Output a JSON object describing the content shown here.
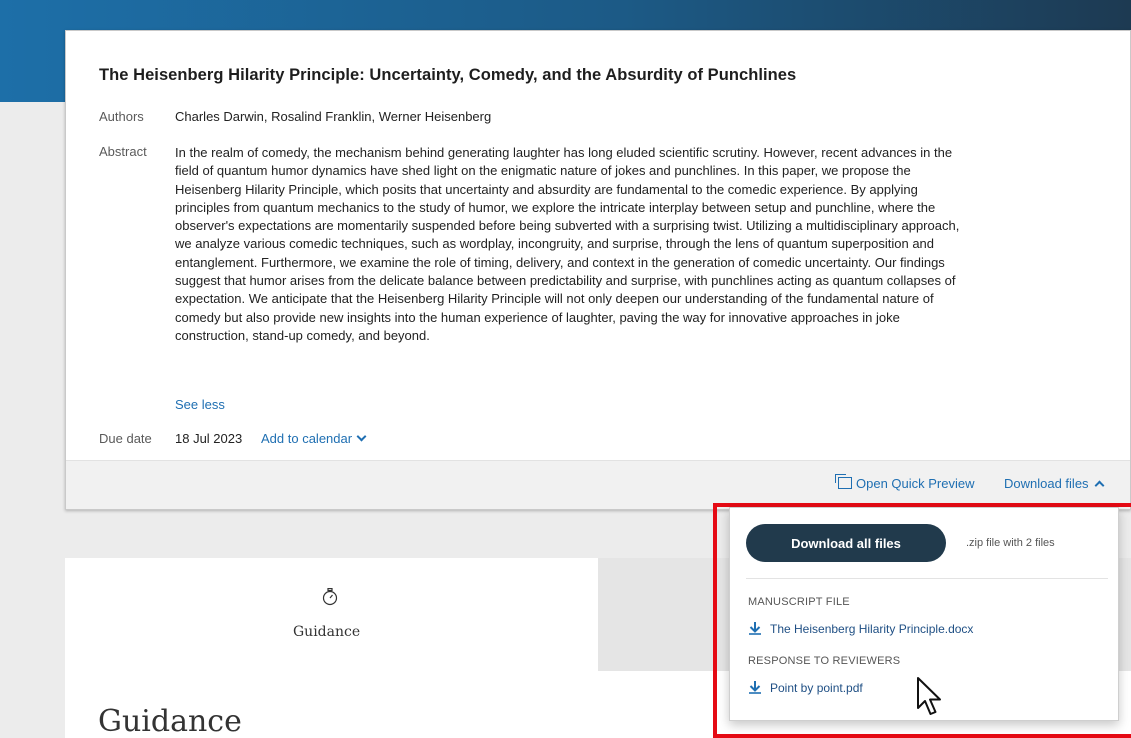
{
  "submission": {
    "title": "The Heisenberg Hilarity Principle: Uncertainty, Comedy, and the Absurdity of Punchlines",
    "authors_label": "Authors",
    "authors": "Charles Darwin, Rosalind Franklin, Werner Heisenberg",
    "abstract_label": "Abstract",
    "abstract": "In the realm of comedy, the mechanism behind generating laughter has long eluded scientific scrutiny. However, recent advances in the field of quantum humor dynamics have shed light on the enigmatic nature of jokes and punchlines. In this paper, we propose the Heisenberg Hilarity Principle, which posits that uncertainty and absurdity are fundamental to the comedic experience. By applying principles from quantum mechanics to the study of humor, we explore the intricate interplay between setup and punchline, where the observer's expectations are momentarily suspended before being subverted with a surprising twist. Utilizing a multidisciplinary approach, we analyze various comedic techniques, such as wordplay, incongruity, and surprise, through the lens of quantum superposition and entanglement. Furthermore, we examine the role of timing, delivery, and context in the generation of comedic uncertainty. Our findings suggest that humor arises from the delicate balance between predictability and surprise, with punchlines acting as quantum collapses of expectation. We anticipate that the Heisenberg Hilarity Principle will not only deepen our understanding of the fundamental nature of comedy but also provide new insights into the human experience of laughter, paving the way for innovative approaches in joke construction, stand-up comedy, and beyond.",
    "see_less": "See less",
    "due_date_label": "Due date",
    "due_date": "18 Jul 2023",
    "add_to_calendar": "Add to calendar"
  },
  "footer": {
    "open_quick_preview": "Open Quick Preview",
    "download_files": "Download files"
  },
  "download_menu": {
    "download_all_label": "Download all files",
    "zip_note": ".zip file with 2 files",
    "sections": [
      {
        "label": "MANUSCRIPT FILE",
        "file": "The Heisenberg Hilarity Principle.docx"
      },
      {
        "label": "RESPONSE TO REVIEWERS",
        "file": "Point by point.pdf"
      }
    ]
  },
  "guidance": {
    "tab_label": "Guidance",
    "heading": "Guidance"
  },
  "colors": {
    "link": "#1f6fb2",
    "button": "#213a4c",
    "highlight": "#e50a14",
    "header_band": "#1c5a86"
  },
  "icons": [
    "preview-icon",
    "chevron-down-icon",
    "chevron-up-icon",
    "stopwatch-icon",
    "download-icon",
    "mouse-pointer-icon"
  ]
}
